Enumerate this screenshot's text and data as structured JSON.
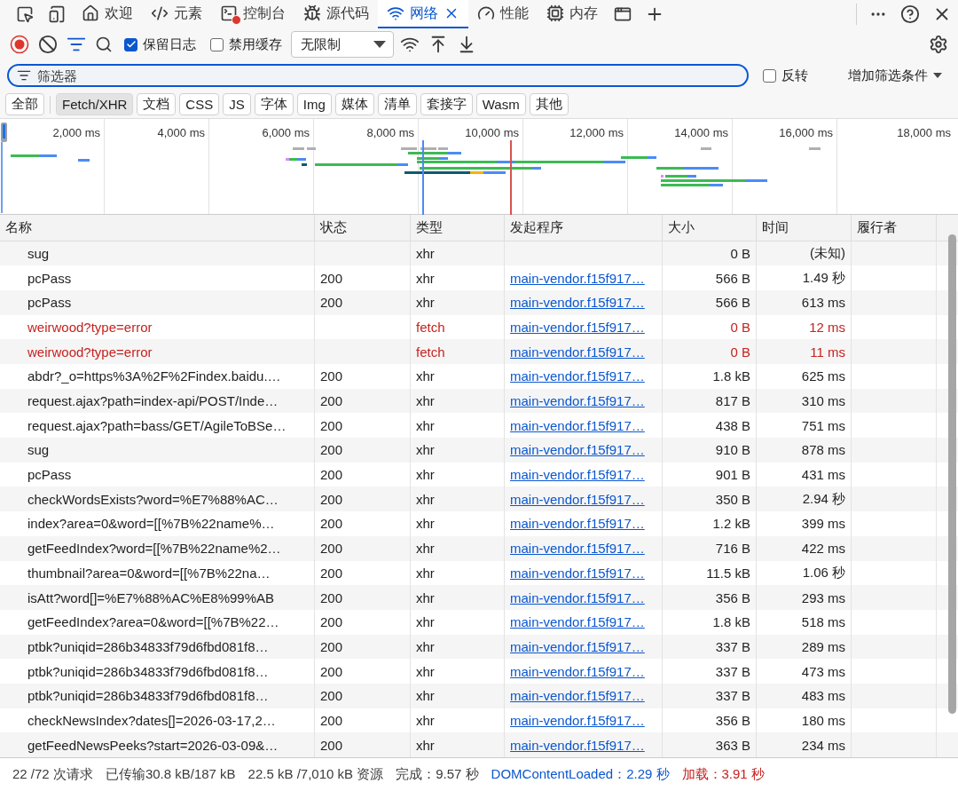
{
  "tabs": [
    {
      "label": "欢迎",
      "kind": "welcome",
      "selected": false,
      "error_badge": false
    },
    {
      "label": "元素",
      "kind": "elements",
      "selected": false,
      "error_badge": false
    },
    {
      "label": "控制台",
      "kind": "console",
      "selected": false,
      "error_badge": true
    },
    {
      "label": "源代码",
      "kind": "sources",
      "selected": false,
      "error_badge": false
    },
    {
      "label": "网络",
      "kind": "network",
      "selected": true,
      "error_badge": false
    },
    {
      "label": "性能",
      "kind": "performance",
      "selected": false,
      "error_badge": false
    },
    {
      "label": "内存",
      "kind": "memory",
      "selected": false,
      "error_badge": false
    }
  ],
  "toolbar": {
    "recording": true,
    "preserve_log": {
      "label": "保留日志",
      "checked": true
    },
    "disable_cache": {
      "label": "禁用缓存",
      "checked": false
    },
    "throttling": "无限制"
  },
  "filter": {
    "placeholder": "筛选器",
    "invert": {
      "label": "反转",
      "checked": false
    },
    "more_filters": "增加筛选条件"
  },
  "type_filters": [
    {
      "label": "全部",
      "selected": false
    },
    {
      "label": "Fetch/XHR",
      "selected": true
    },
    {
      "label": "文档",
      "selected": false
    },
    {
      "label": "CSS",
      "selected": false
    },
    {
      "label": "JS",
      "selected": false
    },
    {
      "label": "字体",
      "selected": false
    },
    {
      "label": "Img",
      "selected": false
    },
    {
      "label": "媒体",
      "selected": false
    },
    {
      "label": "清单",
      "selected": false
    },
    {
      "label": "套接字",
      "selected": false
    },
    {
      "label": "Wasm",
      "selected": false
    },
    {
      "label": "其他",
      "selected": false
    }
  ],
  "timeline": {
    "ticks": [
      "2,000 ms",
      "4,000 ms",
      "6,000 ms",
      "8,000 ms",
      "10,000 ms",
      "12,000 ms",
      "14,000 ms",
      "16,000 ms",
      "18,000 ms"
    ]
  },
  "table": {
    "columns": [
      "名称",
      "状态",
      "类型",
      "发起程序",
      "大小",
      "时间",
      "履行者"
    ],
    "rows": [
      {
        "name": "sug",
        "type": "xhr",
        "size": "0 B",
        "time": "(未知)",
        "failed": false
      },
      {
        "name": "pcPass",
        "status": "200",
        "type": "xhr",
        "initiator": "main-vendor.f15f917…",
        "size": "566 B",
        "time": "1.49 秒",
        "failed": false
      },
      {
        "name": "pcPass",
        "status": "200",
        "type": "xhr",
        "initiator": "main-vendor.f15f917…",
        "size": "566 B",
        "time": "613 ms",
        "failed": false
      },
      {
        "name": "weirwood?type=error",
        "type": "fetch",
        "initiator": "main-vendor.f15f917…",
        "size": "0 B",
        "time": "12 ms",
        "failed": true
      },
      {
        "name": "weirwood?type=error",
        "type": "fetch",
        "initiator": "main-vendor.f15f917…",
        "size": "0 B",
        "time": "11 ms",
        "failed": true
      },
      {
        "name": "abdr?_o=https%3A%2F%2Findex.baidu.…",
        "status": "200",
        "type": "xhr",
        "initiator": "main-vendor.f15f917…",
        "size": "1.8 kB",
        "time": "625 ms",
        "failed": false
      },
      {
        "name": "request.ajax?path=index-api/POST/Inde…",
        "status": "200",
        "type": "xhr",
        "initiator": "main-vendor.f15f917…",
        "size": "817 B",
        "time": "310 ms",
        "failed": false
      },
      {
        "name": "request.ajax?path=bass/GET/AgileToBSe…",
        "status": "200",
        "type": "xhr",
        "initiator": "main-vendor.f15f917…",
        "size": "438 B",
        "time": "751 ms",
        "failed": false
      },
      {
        "name": "sug",
        "status": "200",
        "type": "xhr",
        "initiator": "main-vendor.f15f917…",
        "size": "910 B",
        "time": "878 ms",
        "failed": false
      },
      {
        "name": "pcPass",
        "status": "200",
        "type": "xhr",
        "initiator": "main-vendor.f15f917…",
        "size": "901 B",
        "time": "431 ms",
        "failed": false
      },
      {
        "name": "checkWordsExists?word=%E7%88%AC…",
        "status": "200",
        "type": "xhr",
        "initiator": "main-vendor.f15f917…",
        "size": "350 B",
        "time": "2.94 秒",
        "failed": false
      },
      {
        "name": "index?area=0&word=[[%7B%22name%…",
        "status": "200",
        "type": "xhr",
        "initiator": "main-vendor.f15f917…",
        "size": "1.2 kB",
        "time": "399 ms",
        "failed": false
      },
      {
        "name": "getFeedIndex?word=[[%7B%22name%2…",
        "status": "200",
        "type": "xhr",
        "initiator": "main-vendor.f15f917…",
        "size": "716 B",
        "time": "422 ms",
        "failed": false
      },
      {
        "name": "thumbnail?area=0&word=[[%7B%22na…",
        "status": "200",
        "type": "xhr",
        "initiator": "main-vendor.f15f917…",
        "size": "11.5 kB",
        "time": "1.06 秒",
        "failed": false
      },
      {
        "name": "isAtt?word[]=%E7%88%AC%E8%99%AB",
        "status": "200",
        "type": "xhr",
        "initiator": "main-vendor.f15f917…",
        "size": "356 B",
        "time": "293 ms",
        "failed": false
      },
      {
        "name": "getFeedIndex?area=0&word=[[%7B%22…",
        "status": "200",
        "type": "xhr",
        "initiator": "main-vendor.f15f917…",
        "size": "1.8 kB",
        "time": "518 ms",
        "failed": false
      },
      {
        "name": "ptbk?uniqid=286b34833f79d6fbd081f8…",
        "status": "200",
        "type": "xhr",
        "initiator": "main-vendor.f15f917…",
        "size": "337 B",
        "time": "289 ms",
        "failed": false
      },
      {
        "name": "ptbk?uniqid=286b34833f79d6fbd081f8…",
        "status": "200",
        "type": "xhr",
        "initiator": "main-vendor.f15f917…",
        "size": "337 B",
        "time": "473 ms",
        "failed": false
      },
      {
        "name": "ptbk?uniqid=286b34833f79d6fbd081f8…",
        "status": "200",
        "type": "xhr",
        "initiator": "main-vendor.f15f917…",
        "size": "337 B",
        "time": "483 ms",
        "failed": false
      },
      {
        "name": "checkNewsIndex?dates[]=2026-03-17,2…",
        "status": "200",
        "type": "xhr",
        "initiator": "main-vendor.f15f917…",
        "size": "356 B",
        "time": "180 ms",
        "failed": false
      },
      {
        "name": "getFeedNewsPeeks?start=2026-03-09&…",
        "status": "200",
        "type": "xhr",
        "initiator": "main-vendor.f15f917…",
        "size": "363 B",
        "time": "234 ms",
        "failed": false
      }
    ]
  },
  "status_bar": [
    {
      "text": "22 /72 次请求",
      "kind": "plain"
    },
    {
      "text": "已传输30.8 kB/187 kB",
      "kind": "plain"
    },
    {
      "text": "22.5 kB /7,010 kB 资源",
      "kind": "plain"
    },
    {
      "text": "完成：9.57 秒",
      "kind": "plain"
    },
    {
      "text": "DOMContentLoaded：2.29 秒",
      "kind": "dom"
    },
    {
      "text": "加载：3.91 秒",
      "kind": "load"
    }
  ]
}
